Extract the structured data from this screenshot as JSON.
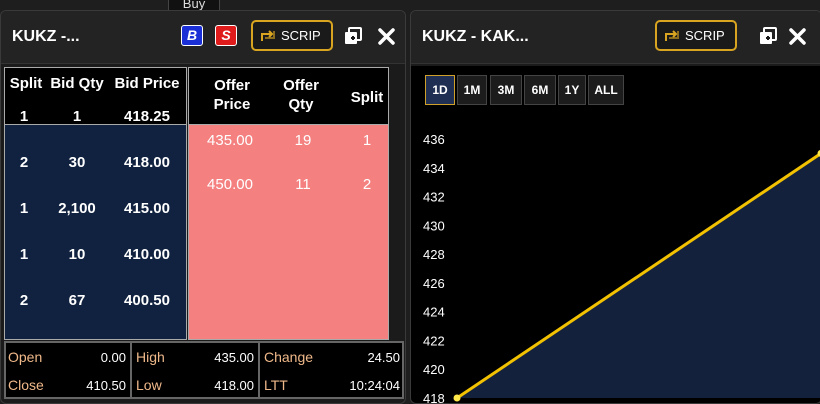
{
  "tooltip": "Buy",
  "left": {
    "title": "KUKZ -...",
    "buy_label": "B",
    "sell_label": "S",
    "scrip_label": "SCRIP",
    "bid_headers": [
      "Split",
      "Bid Qty",
      "Bid Price"
    ],
    "offer_headers": [
      "Offer Price",
      "Offer Qty",
      "Split"
    ],
    "bids": [
      {
        "split": "1",
        "qty": "1",
        "price": "418.25"
      },
      {
        "split": "2",
        "qty": "30",
        "price": "418.00"
      },
      {
        "split": "1",
        "qty": "2,100",
        "price": "415.00"
      },
      {
        "split": "1",
        "qty": "10",
        "price": "410.00"
      },
      {
        "split": "2",
        "qty": "67",
        "price": "400.50"
      }
    ],
    "offers": [
      {
        "price": "435.00",
        "qty": "19",
        "split": "1"
      },
      {
        "price": "450.00",
        "qty": "11",
        "split": "2"
      }
    ],
    "stats": {
      "open_label": "Open",
      "open": "0.00",
      "close_label": "Close",
      "close": "410.50",
      "high_label": "High",
      "high": "435.00",
      "low_label": "Low",
      "low": "418.00",
      "change_label": "Change",
      "change": "24.50",
      "ltt_label": "LTT",
      "ltt": "10:24:04"
    }
  },
  "right": {
    "title": "KUKZ - KAK...",
    "scrip_label": "SCRIP",
    "ranges": [
      "1D",
      "1M",
      "3M",
      "6M",
      "1Y",
      "ALL"
    ],
    "active_range": "1D"
  },
  "colors": {
    "bid_bg": "#10223f",
    "offer_bg": "#f48080",
    "accent": "#d9a521",
    "line": "#f2c200",
    "area": "#14213d",
    "stat_label": "#f0b98a"
  },
  "chart_data": {
    "type": "area",
    "x": [
      0,
      1
    ],
    "values": [
      418,
      435
    ],
    "ylim": [
      418,
      436
    ],
    "yticks": [
      436,
      434,
      432,
      430,
      428,
      426,
      424,
      422,
      420,
      418
    ],
    "grid": false,
    "legend": "none"
  }
}
